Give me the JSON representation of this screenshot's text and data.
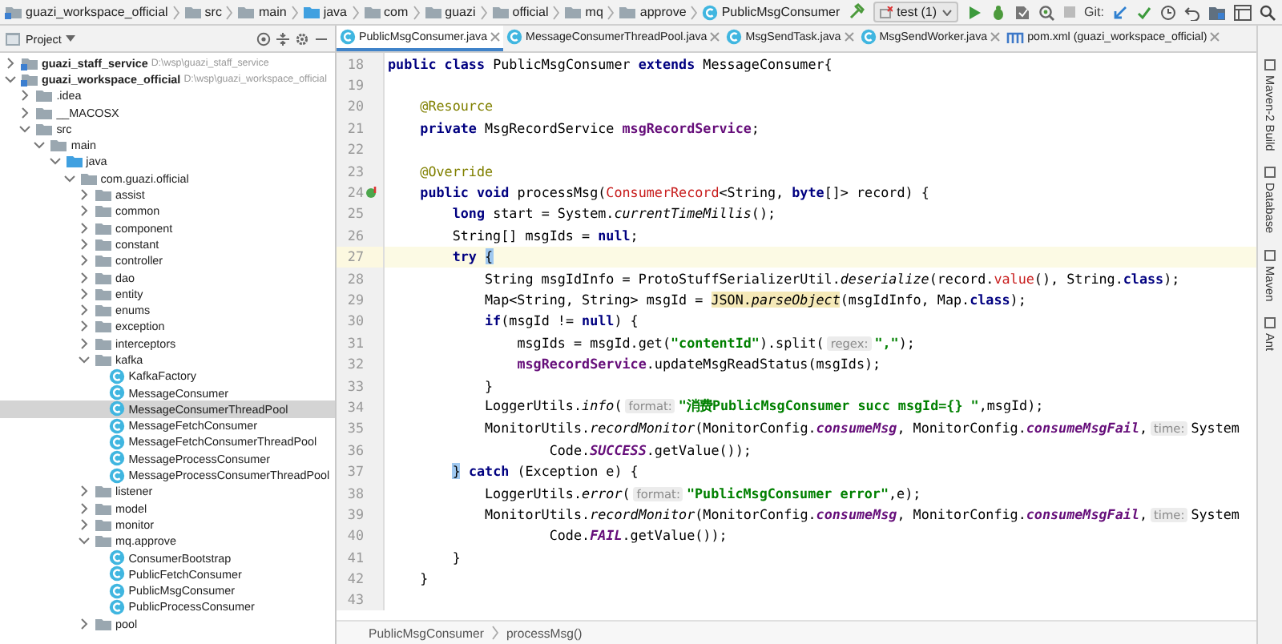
{
  "nav_bar": {
    "breadcrumbs": [
      {
        "label": "guazi_workspace_official",
        "kind": "module"
      },
      {
        "label": "src",
        "kind": "folder"
      },
      {
        "label": "main",
        "kind": "folder"
      },
      {
        "label": "java",
        "kind": "source"
      },
      {
        "label": "com",
        "kind": "folder"
      },
      {
        "label": "guazi",
        "kind": "folder"
      },
      {
        "label": "official",
        "kind": "folder"
      },
      {
        "label": "mq",
        "kind": "folder"
      },
      {
        "label": "approve",
        "kind": "folder"
      },
      {
        "label": "PublicMsgConsumer",
        "kind": "class"
      }
    ],
    "run_config": "test (1)",
    "git_label": "Git:"
  },
  "project_panel": {
    "title": "Project",
    "tree": [
      {
        "label": "guazi_staff_service",
        "path": "D:\\wsp\\guazi_staff_service",
        "kind": "module",
        "expanded": false,
        "selected": false
      },
      {
        "label": "guazi_workspace_official",
        "path": "D:\\wsp\\guazi_workspace_official",
        "kind": "module",
        "expanded": true,
        "selected": false,
        "children": [
          {
            "label": ".idea",
            "kind": "folder",
            "expanded": false,
            "selected": false
          },
          {
            "label": "__MACOSX",
            "kind": "folder",
            "expanded": false,
            "selected": false
          },
          {
            "label": "src",
            "kind": "folder",
            "expanded": true,
            "selected": false,
            "children": [
              {
                "label": "main",
                "kind": "folder",
                "expanded": true,
                "selected": false,
                "children": [
                  {
                    "label": "java",
                    "kind": "source",
                    "expanded": true,
                    "selected": false,
                    "children": [
                      {
                        "label": "com.guazi.official",
                        "kind": "package",
                        "expanded": true,
                        "selected": false,
                        "children": [
                          {
                            "label": "assist",
                            "kind": "package",
                            "expanded": false,
                            "selected": false
                          },
                          {
                            "label": "common",
                            "kind": "package",
                            "expanded": false,
                            "selected": false
                          },
                          {
                            "label": "component",
                            "kind": "package",
                            "expanded": false,
                            "selected": false
                          },
                          {
                            "label": "constant",
                            "kind": "package",
                            "expanded": false,
                            "selected": false
                          },
                          {
                            "label": "controller",
                            "kind": "package",
                            "expanded": false,
                            "selected": false
                          },
                          {
                            "label": "dao",
                            "kind": "package",
                            "expanded": false,
                            "selected": false
                          },
                          {
                            "label": "entity",
                            "kind": "package",
                            "expanded": false,
                            "selected": false
                          },
                          {
                            "label": "enums",
                            "kind": "package",
                            "expanded": false,
                            "selected": false
                          },
                          {
                            "label": "exception",
                            "kind": "package",
                            "expanded": false,
                            "selected": false
                          },
                          {
                            "label": "interceptors",
                            "kind": "package",
                            "expanded": false,
                            "selected": false
                          },
                          {
                            "label": "kafka",
                            "kind": "package",
                            "expanded": true,
                            "selected": false,
                            "children": [
                              {
                                "label": "KafkaFactory",
                                "kind": "class",
                                "selected": false
                              },
                              {
                                "label": "MessageConsumer",
                                "kind": "class",
                                "selected": false
                              },
                              {
                                "label": "MessageConsumerThreadPool",
                                "kind": "class",
                                "selected": true
                              },
                              {
                                "label": "MessageFetchConsumer",
                                "kind": "class",
                                "selected": false
                              },
                              {
                                "label": "MessageFetchConsumerThreadPool",
                                "kind": "class",
                                "selected": false
                              },
                              {
                                "label": "MessageProcessConsumer",
                                "kind": "class",
                                "selected": false
                              },
                              {
                                "label": "MessageProcessConsumerThreadPool",
                                "kind": "class",
                                "selected": false
                              }
                            ]
                          },
                          {
                            "label": "listener",
                            "kind": "package",
                            "expanded": false,
                            "selected": false
                          },
                          {
                            "label": "model",
                            "kind": "package",
                            "expanded": false,
                            "selected": false
                          },
                          {
                            "label": "monitor",
                            "kind": "package",
                            "expanded": false,
                            "selected": false
                          },
                          {
                            "label": "mq.approve",
                            "kind": "package",
                            "expanded": true,
                            "selected": false,
                            "children": [
                              {
                                "label": "ConsumerBootstrap",
                                "kind": "class",
                                "selected": false
                              },
                              {
                                "label": "PublicFetchConsumer",
                                "kind": "class",
                                "selected": false
                              },
                              {
                                "label": "PublicMsgConsumer",
                                "kind": "class",
                                "selected": false
                              },
                              {
                                "label": "PublicProcessConsumer",
                                "kind": "class",
                                "selected": false
                              }
                            ]
                          },
                          {
                            "label": "pool",
                            "kind": "package",
                            "expanded": false,
                            "selected": false
                          }
                        ]
                      }
                    ]
                  }
                ]
              }
            ]
          }
        ]
      }
    ]
  },
  "editor_tabs": [
    {
      "label": "PublicMsgConsumer.java",
      "kind": "class",
      "selected": true
    },
    {
      "label": "MessageConsumerThreadPool.java",
      "kind": "class",
      "selected": false
    },
    {
      "label": "MsgSendTask.java",
      "kind": "class",
      "selected": false
    },
    {
      "label": "MsgSendWorker.java",
      "kind": "class",
      "selected": false
    },
    {
      "label": "pom.xml (guazi_workspace_official)",
      "kind": "maven",
      "selected": false
    }
  ],
  "code_lines": [
    {
      "number": "18",
      "current": false,
      "tokens": [
        {
          "text": "public class",
          "kind": "kw"
        },
        {
          "text": " PublicMsgConsumer ",
          "kind": "plain"
        },
        {
          "text": "extends",
          "kind": "kw"
        },
        {
          "text": " MessageConsumer{",
          "kind": "plain"
        }
      ]
    },
    {
      "number": "19",
      "current": false
    },
    {
      "number": "20",
      "current": false,
      "tokens": [
        {
          "text": "    @Resource",
          "kind": "ann"
        }
      ]
    },
    {
      "number": "21",
      "current": false,
      "tokens": [
        {
          "text": "    private",
          "kind": "kw"
        },
        {
          "text": " MsgRecordService ",
          "kind": "plain"
        },
        {
          "text": "msgRecordService",
          "kind": "field"
        },
        {
          "text": ";",
          "kind": "plain"
        }
      ]
    },
    {
      "number": "22",
      "current": false
    },
    {
      "number": "23",
      "current": false,
      "tokens": [
        {
          "text": "    @Override",
          "kind": "ann"
        }
      ]
    },
    {
      "number": "24",
      "current": false,
      "gutter": {
        "kind": "override"
      },
      "tokens": [
        {
          "text": "    public void",
          "kind": "kw"
        },
        {
          "text": " processMsg(",
          "kind": "plain"
        },
        {
          "text": "ConsumerRecord",
          "kind": "red"
        },
        {
          "text": "<String, ",
          "kind": "plain"
        },
        {
          "text": "byte",
          "kind": "kw"
        },
        {
          "text": "[]> record) {",
          "kind": "plain"
        }
      ]
    },
    {
      "number": "25",
      "current": false,
      "tokens": [
        {
          "text": "        long",
          "kind": "kw"
        },
        {
          "text": " start = System.",
          "kind": "plain"
        },
        {
          "text": "currentTimeMillis",
          "kind": "italic"
        },
        {
          "text": "();",
          "kind": "plain"
        }
      ]
    },
    {
      "number": "26",
      "current": false,
      "tokens": [
        {
          "text": "        String[] msgIds = ",
          "kind": "plain"
        },
        {
          "text": "null",
          "kind": "kw"
        },
        {
          "text": ";",
          "kind": "plain"
        }
      ]
    },
    {
      "number": "27",
      "current": true,
      "tokens": [
        {
          "text": "        try",
          "kind": "kw"
        },
        {
          "text": " {",
          "kind": "brace"
        }
      ]
    },
    {
      "number": "28",
      "current": false,
      "tokens": [
        {
          "text": "            String msgIdInfo = ProtoStuffSerializerUtil.",
          "kind": "plain"
        },
        {
          "text": "deserialize",
          "kind": "italic"
        },
        {
          "text": "(record.",
          "kind": "plain"
        },
        {
          "text": "value",
          "kind": "red"
        },
        {
          "text": "(), String.",
          "kind": "plain"
        },
        {
          "text": "class",
          "kind": "kw"
        },
        {
          "text": ");",
          "kind": "plain"
        }
      ]
    },
    {
      "number": "29",
      "current": false,
      "tokens": [
        {
          "text": "            Map<String, String> msgId = ",
          "kind": "plain"
        },
        {
          "text": "JSON.",
          "kind": "hl"
        },
        {
          "text": "parseObject",
          "kind": "hlit"
        },
        {
          "text": "(msgIdInfo, Map.",
          "kind": "plain"
        },
        {
          "text": "class",
          "kind": "kw"
        },
        {
          "text": ");",
          "kind": "plain"
        }
      ]
    },
    {
      "number": "30",
      "current": false,
      "tokens": [
        {
          "text": "            if",
          "kind": "kw"
        },
        {
          "text": "(msgId != ",
          "kind": "plain"
        },
        {
          "text": "null",
          "kind": "kw"
        },
        {
          "text": ") {",
          "kind": "plain"
        }
      ]
    },
    {
      "number": "31",
      "current": false,
      "tokens": [
        {
          "text": "                msgIds = msgId.get(",
          "kind": "plain"
        },
        {
          "text": "\"contentId\"",
          "kind": "str"
        },
        {
          "text": ").split(",
          "kind": "plain"
        },
        {
          "text": "regex:",
          "kind": "hint"
        },
        {
          "text": "\",\"",
          "kind": "str"
        },
        {
          "text": ");",
          "kind": "plain"
        }
      ]
    },
    {
      "number": "32",
      "current": false,
      "tokens": [
        {
          "text": "                msgRecordService",
          "kind": "field"
        },
        {
          "text": ".updateMsgReadStatus(msgIds);",
          "kind": "plain"
        }
      ]
    },
    {
      "number": "33",
      "current": false,
      "tokens": [
        {
          "text": "            }",
          "kind": "plain"
        }
      ]
    },
    {
      "number": "34",
      "current": false,
      "tokens": [
        {
          "text": "            LoggerUtils.",
          "kind": "plain"
        },
        {
          "text": "info",
          "kind": "italic"
        },
        {
          "text": "(",
          "kind": "plain"
        },
        {
          "text": "format:",
          "kind": "hint"
        },
        {
          "text": "\"消费PublicMsgConsumer succ msgId={} \"",
          "kind": "str"
        },
        {
          "text": ",msgId);",
          "kind": "plain"
        }
      ]
    },
    {
      "number": "35",
      "current": false,
      "tokens": [
        {
          "text": "            MonitorUtils.",
          "kind": "plain"
        },
        {
          "text": "recordMonitor",
          "kind": "italic"
        },
        {
          "text": "(MonitorConfig.",
          "kind": "plain"
        },
        {
          "text": "consumeMsg",
          "kind": "static"
        },
        {
          "text": ", MonitorConfig.",
          "kind": "plain"
        },
        {
          "text": "consumeMsgFail",
          "kind": "static"
        },
        {
          "text": ",",
          "kind": "plain"
        },
        {
          "text": "time:",
          "kind": "hint"
        },
        {
          "text": "System",
          "kind": "plain"
        }
      ]
    },
    {
      "number": "36",
      "current": false,
      "tokens": [
        {
          "text": "                    Code.",
          "kind": "plain"
        },
        {
          "text": "SUCCESS",
          "kind": "static"
        },
        {
          "text": ".getValue());",
          "kind": "plain"
        }
      ]
    },
    {
      "number": "37",
      "current": false,
      "tokens": [
        {
          "text": "        }",
          "kind": "brace"
        },
        {
          "text": " catch",
          "kind": "kw"
        },
        {
          "text": " (Exception e) {",
          "kind": "plain"
        }
      ]
    },
    {
      "number": "38",
      "current": false,
      "tokens": [
        {
          "text": "            LoggerUtils.",
          "kind": "plain"
        },
        {
          "text": "error",
          "kind": "italic"
        },
        {
          "text": "(",
          "kind": "plain"
        },
        {
          "text": "format:",
          "kind": "hint"
        },
        {
          "text": "\"PublicMsgConsumer error\"",
          "kind": "str"
        },
        {
          "text": ",e);",
          "kind": "plain"
        }
      ]
    },
    {
      "number": "39",
      "current": false,
      "tokens": [
        {
          "text": "            MonitorUtils.",
          "kind": "plain"
        },
        {
          "text": "recordMonitor",
          "kind": "italic"
        },
        {
          "text": "(MonitorConfig.",
          "kind": "plain"
        },
        {
          "text": "consumeMsg",
          "kind": "static"
        },
        {
          "text": ", MonitorConfig.",
          "kind": "plain"
        },
        {
          "text": "consumeMsgFail",
          "kind": "static"
        },
        {
          "text": ",",
          "kind": "plain"
        },
        {
          "text": "time:",
          "kind": "hint"
        },
        {
          "text": "System",
          "kind": "plain"
        }
      ]
    },
    {
      "number": "40",
      "current": false,
      "tokens": [
        {
          "text": "                    Code.",
          "kind": "plain"
        },
        {
          "text": "FAIL",
          "kind": "static"
        },
        {
          "text": ".getValue());",
          "kind": "plain"
        }
      ]
    },
    {
      "number": "41",
      "current": false,
      "tokens": [
        {
          "text": "        }",
          "kind": "plain"
        }
      ]
    },
    {
      "number": "42",
      "current": false,
      "tokens": [
        {
          "text": "    }",
          "kind": "plain"
        }
      ]
    },
    {
      "number": "43",
      "current": false
    }
  ],
  "editor_breadcrumbs": [
    "PublicMsgConsumer",
    "processMsg()"
  ],
  "tool_strip": [
    {
      "label": "Maven-2 Build"
    },
    {
      "label": "Database"
    },
    {
      "label": "Maven"
    },
    {
      "label": "Ant"
    }
  ]
}
